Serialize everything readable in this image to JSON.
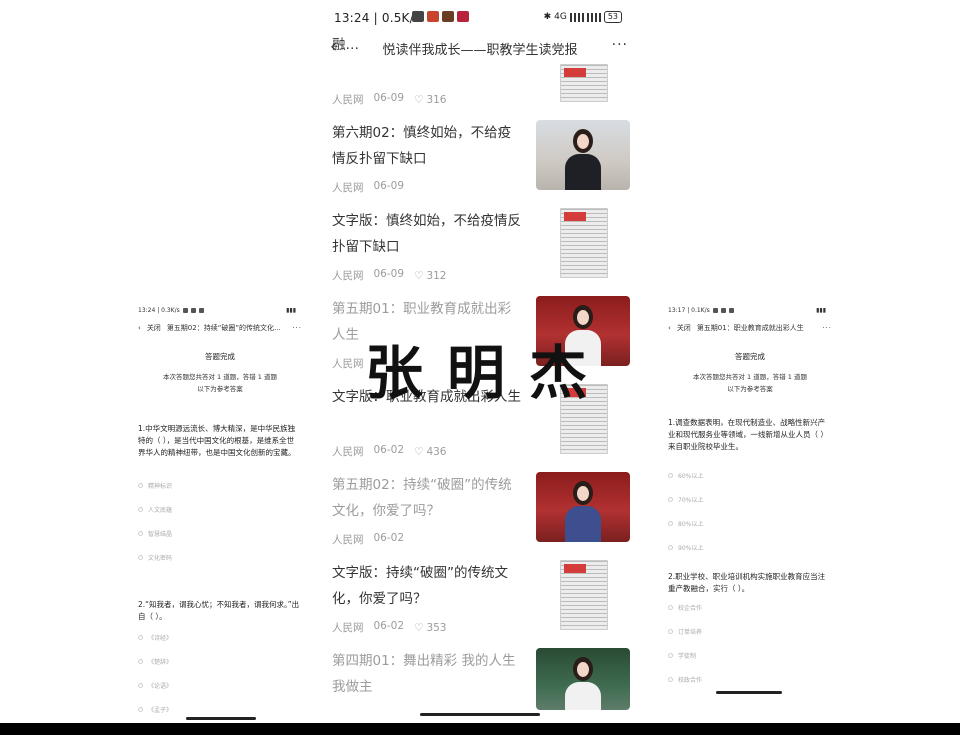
{
  "main": {
    "status_bar": {
      "time": "13:24",
      "speed": "0.5K/s",
      "network": "4G",
      "battery": "53"
    },
    "nav": {
      "back_icon": "chevron-left",
      "title": "悦读伴我成长——职教学生读党报",
      "more_icon": "ellipsis"
    },
    "items": [
      {
        "title": "融…",
        "source": "人民网",
        "date": "06-09",
        "likes": "316",
        "thumb": "newspaper",
        "faded": false
      },
      {
        "title": "第六期02：慎终如始，不给疫情反扑留下缺口",
        "source": "人民网",
        "date": "06-09",
        "likes": "",
        "thumb": "video-woman",
        "faded": false
      },
      {
        "title": "文字版：慎终如始，不给疫情反扑留下缺口",
        "source": "人民网",
        "date": "06-09",
        "likes": "312",
        "thumb": "newspaper",
        "faded": false
      },
      {
        "title": "第五期01：职业教育成就出彩人生",
        "source": "人民网",
        "date": "",
        "likes": "",
        "thumb": "video-woman",
        "faded": true
      },
      {
        "title": "文字版：职业教育成就出彩人生",
        "source": "人民网",
        "date": "06-02",
        "likes": "436",
        "thumb": "newspaper",
        "faded": false
      },
      {
        "title": "第五期02：持续“破圈”的传统文化，你爱了吗？",
        "source": "人民网",
        "date": "06-02",
        "likes": "",
        "thumb": "video-woman",
        "faded": true
      },
      {
        "title": "文字版：持续“破圈”的传统文化，你爱了吗？",
        "source": "人民网",
        "date": "06-02",
        "likes": "353",
        "thumb": "newspaper",
        "faded": false
      },
      {
        "title": "第四期01：舞出精彩 我的人生我做主",
        "source": "",
        "date": "",
        "likes": "",
        "thumb": "video-woman",
        "faded": true
      }
    ]
  },
  "watermark": "张明杰",
  "left_phone": {
    "status": "13:24 | 0.3K/s",
    "nav_close": "关闭",
    "nav_title": "第五期02：持续“破圈”的传统文化...",
    "done": "答题完成",
    "summary_line1": "本次答题您共答对 1 道题，答错 1 道题",
    "summary_line2": "以下为参考答案",
    "q1": "1.中华文明源远流长、博大精深，是中华民族独特的（ ），是当代中国文化的根基，是维系全世界华人的精神纽带，也是中国文化创新的宝藏。",
    "q1_options": [
      "精神标识",
      "人文底蕴",
      "智慧结晶",
      "文化密码"
    ],
    "q2": "2.“知我者，谓我心忧；不知我者，谓我何求。”出自（ ）。",
    "q2_options": [
      "《诗经》",
      "《楚辞》",
      "《论语》",
      "《孟子》"
    ]
  },
  "right_phone": {
    "status": "13:17 | 0.1K/s",
    "nav_close": "关闭",
    "nav_title": "第五期01：职业教育成就出彩人生",
    "done": "答题完成",
    "summary_line1": "本次答题您共答对 1 道题，答错 1 道题",
    "summary_line2": "以下为参考答案",
    "q1": "1.调查数据表明，在现代制造业、战略性新兴产业和现代服务业等领域，一线新增从业人员（ ）来自职业院校毕业生。",
    "q1_options": [
      "60%以上",
      "70%以上",
      "80%以上",
      "90%以上"
    ],
    "q2": "2.职业学校、职业培训机构实施职业教育应当注重产教融合，实行（ ）。",
    "q2_options": [
      "校企合作",
      "订单培养",
      "学徒制",
      "校政合作"
    ]
  }
}
